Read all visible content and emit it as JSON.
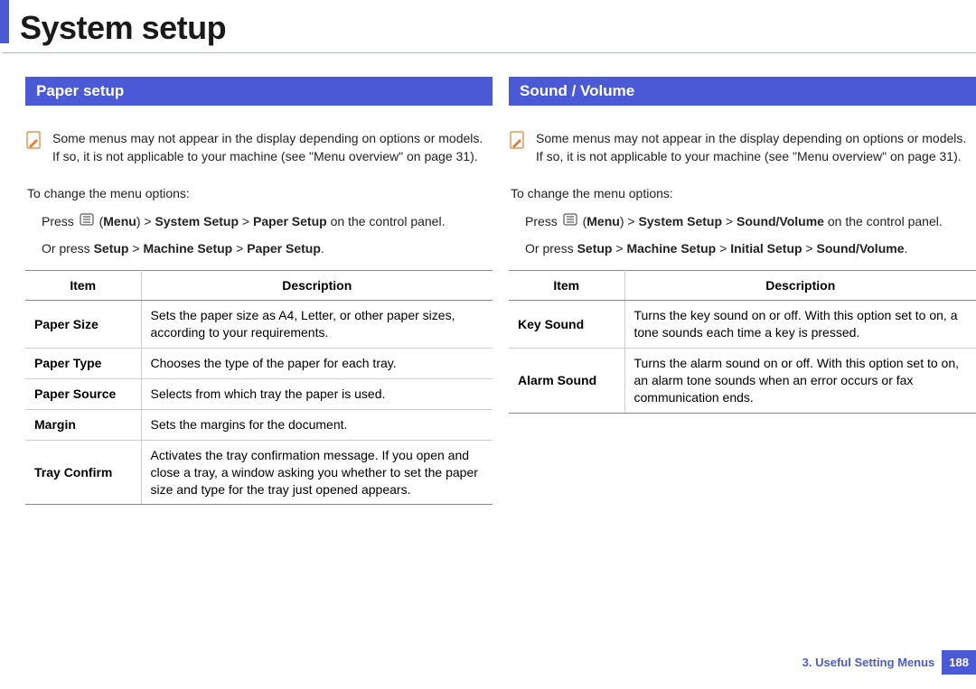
{
  "page_title": "System setup",
  "left": {
    "section_title": "Paper setup",
    "note": "Some menus may not appear in the display depending on options or models. If so, it is not applicable to your machine (see \"Menu overview\" on page 31).",
    "change_label": "To change the menu options:",
    "press1_pre": "Press",
    "press1_menu": "Menu",
    "press1_mid": ") > ",
    "press1_b1": "System Setup",
    "press1_sep1": " > ",
    "press1_b2": "Paper Setup",
    "press1_post": " on the control panel.",
    "press2_pre": "Or press ",
    "press2_b1": "Setup",
    "press2_sep1": " > ",
    "press2_b2": "Machine Setup",
    "press2_sep2": " > ",
    "press2_b3": "Paper Setup",
    "press2_post": ".",
    "th_item": "Item",
    "th_desc": "Description",
    "rows": [
      {
        "item": "Paper Size",
        "desc": "Sets the paper size as A4, Letter, or other paper sizes, according to your requirements."
      },
      {
        "item": "Paper Type",
        "desc": "Chooses the type of the paper for each tray."
      },
      {
        "item": "Paper Source",
        "desc": "Selects from which tray the paper is used."
      },
      {
        "item": "Margin",
        "desc": "Sets the margins for the document."
      },
      {
        "item": "Tray Confirm",
        "desc": "Activates the tray confirmation message. If you open and close a tray, a window asking you whether to set the paper size and type for the tray just opened appears."
      }
    ]
  },
  "right": {
    "section_title": "Sound / Volume",
    "note": "Some menus may not appear in the display depending on options or models. If so, it is not applicable to your machine (see \"Menu overview\" on page 31).",
    "change_label": "To change the menu options:",
    "press1_pre": "Press",
    "press1_menu": "Menu",
    "press1_mid": ") > ",
    "press1_b1": "System Setup",
    "press1_sep1": " > ",
    "press1_b2": "Sound/Volume",
    "press1_post": " on the control panel.",
    "press2_pre": "Or press ",
    "press2_b1": "Setup",
    "press2_sep1": " > ",
    "press2_b2": "Machine Setup",
    "press2_sep2": " > ",
    "press2_b3": "Initial Setup",
    "press2_sep3": " > ",
    "press2_b4": "Sound/Volume",
    "press2_post": ".",
    "th_item": "Item",
    "th_desc": "Description",
    "rows": [
      {
        "item": "Key Sound",
        "desc": "Turns the key sound on or off. With this option set to on, a tone sounds each time a key is pressed."
      },
      {
        "item": "Alarm Sound",
        "desc": "Turns the alarm sound on or off. With this option set to on, an alarm tone sounds when an error occurs or fax communication ends."
      }
    ]
  },
  "footer_label": "3.  Useful Setting Menus",
  "page_number": "188"
}
